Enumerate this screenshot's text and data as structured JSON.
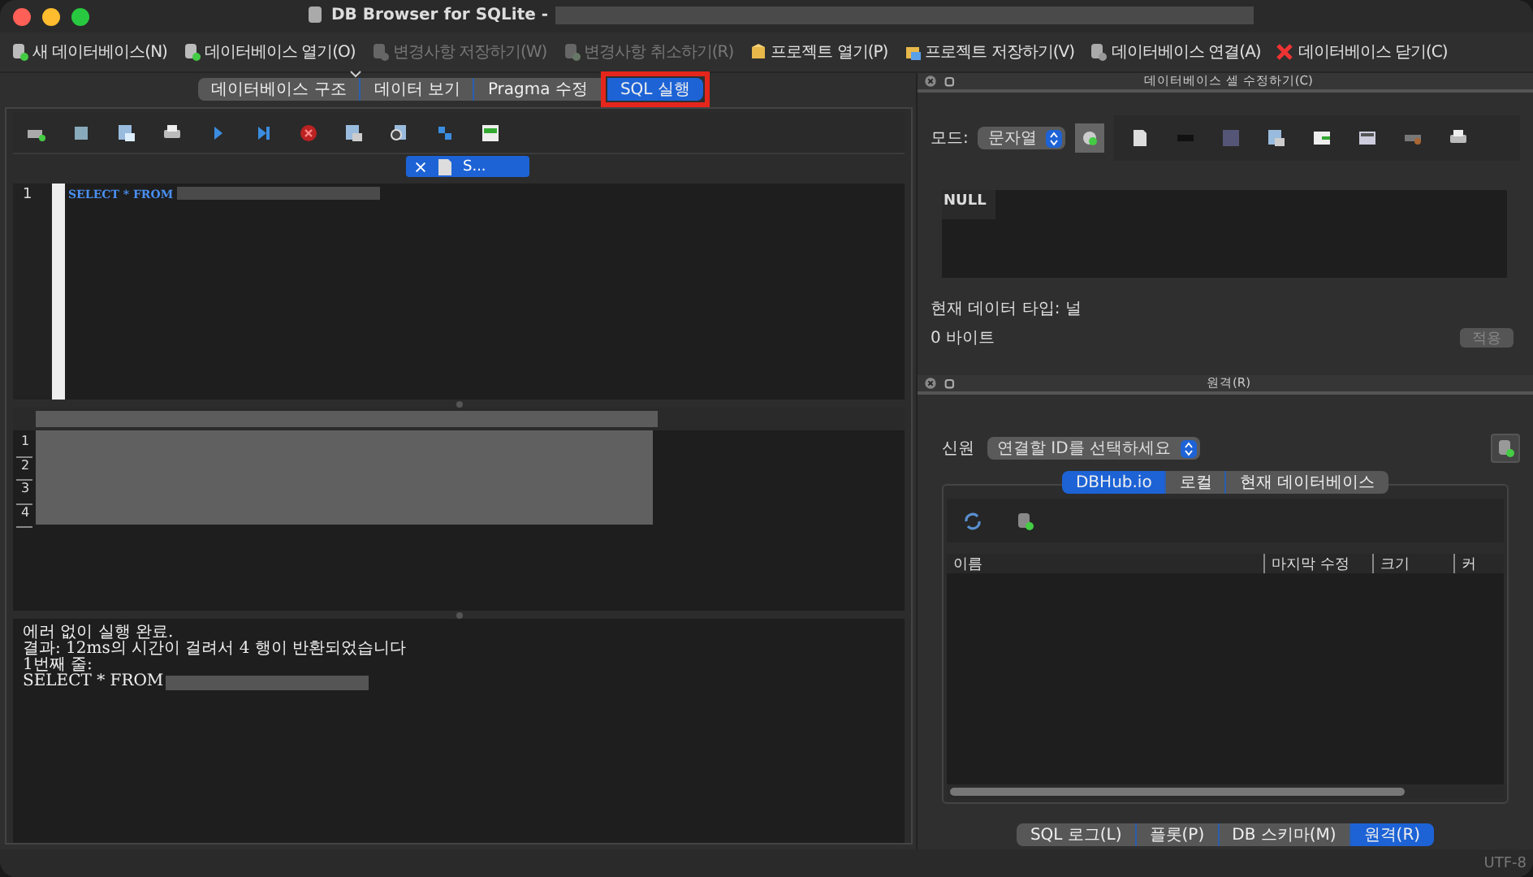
{
  "window": {
    "title": "DB Browser for SQLite -"
  },
  "toolbar": [
    {
      "label": "새 데이터베이스(N)",
      "disabled": false,
      "dropdown": false
    },
    {
      "label": "데이터베이스 열기(O)",
      "disabled": false,
      "dropdown": true
    },
    {
      "label": "변경사항 저장하기(W)",
      "disabled": true,
      "dropdown": false
    },
    {
      "label": "변경사항 취소하기(R)",
      "disabled": true,
      "dropdown": false
    },
    {
      "label": "프로젝트 열기(P)",
      "disabled": false,
      "dropdown": false
    },
    {
      "label": "프로젝트 저장하기(V)",
      "disabled": false,
      "dropdown": false
    },
    {
      "label": "데이터베이스 연결(A)",
      "disabled": false,
      "dropdown": false
    },
    {
      "label": "데이터베이스 닫기(C)",
      "disabled": false,
      "dropdown": false
    }
  ],
  "main_tabs": [
    {
      "label": "데이터베이스 구조",
      "selected": false
    },
    {
      "label": "데이터 보기",
      "selected": false
    },
    {
      "label": "Pragma 수정",
      "selected": false
    },
    {
      "label": "SQL 실행",
      "selected": true
    }
  ],
  "editor_tabs": [
    {
      "label": "S...",
      "selected": true
    }
  ],
  "editor": {
    "lines": [
      {
        "number": "1",
        "code": "SELECT * FROM"
      }
    ]
  },
  "results": {
    "row_numbers": [
      "1",
      "2",
      "3",
      "4"
    ]
  },
  "messages": [
    "에러 없이 실행 완료.",
    "결과: 12ms의 시간이 걸려서 4 행이 반환되었습니다",
    "1번째 줄:",
    "SELECT * FROM"
  ],
  "cell_editor": {
    "title": "데이터베이스 셀 수정하기(C)",
    "mode_label": "모드:",
    "mode_value": "문자열",
    "value": "NULL",
    "type_text": "현재 데이터 타입: 널",
    "size_text": "0 바이트",
    "apply": {
      "label": "적용",
      "disabled": true
    }
  },
  "remote": {
    "title": "원격(R)",
    "identity_label": "신원",
    "identity_value": "연결할 ID를 선택하세요",
    "tabs": [
      {
        "label": "DBHub.io",
        "selected": true
      },
      {
        "label": "로컬",
        "selected": false
      },
      {
        "label": "현재 데이터베이스",
        "selected": false
      }
    ],
    "columns": [
      "이름",
      "마지막 수정",
      "크기",
      "커"
    ]
  },
  "bottom_tabs": [
    {
      "label": "SQL 로그(L)",
      "selected": false
    },
    {
      "label": "플롯(P)",
      "selected": false
    },
    {
      "label": "DB 스키마(M)",
      "selected": false
    },
    {
      "label": "원격(R)",
      "selected": true
    }
  ],
  "status_bar": {
    "encoding": "UTF-8"
  }
}
